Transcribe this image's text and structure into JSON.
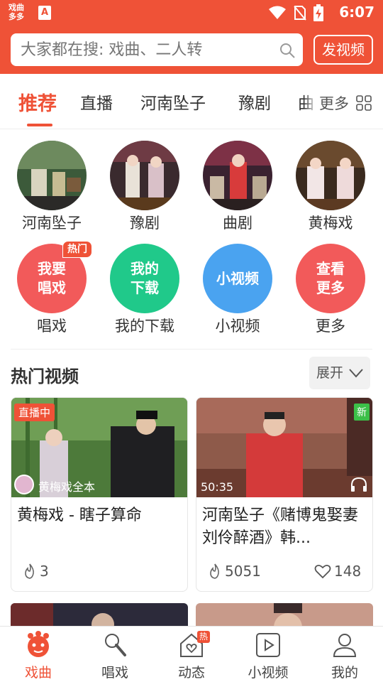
{
  "status_bar": {
    "app_logo": "戏曲多多",
    "time": "6:07"
  },
  "search": {
    "placeholder": "大家都在搜: 戏曲、二人转",
    "post_video_label": "发视频"
  },
  "tabs": [
    {
      "label": "推荐",
      "active": true
    },
    {
      "label": "直播"
    },
    {
      "label": "河南坠子"
    },
    {
      "label": "豫剧"
    },
    {
      "label": "曲"
    }
  ],
  "more_label": "更多",
  "categories": [
    {
      "label": "河南坠子"
    },
    {
      "label": "豫剧"
    },
    {
      "label": "曲剧"
    },
    {
      "label": "黄梅戏"
    }
  ],
  "functions": [
    {
      "circle_text": "我要唱戏",
      "label": "唱戏",
      "badge": "热门",
      "color": "#f25a5a"
    },
    {
      "circle_text": "我的下载",
      "label": "我的下载",
      "color": "#20c98a"
    },
    {
      "circle_text": "小视频",
      "label": "小视频",
      "color": "#4aa3f0"
    },
    {
      "circle_text": "查看更多",
      "label": "更多",
      "color": "#f25a5a"
    }
  ],
  "hot_videos": {
    "title": "热门视频",
    "expand_label": "展开",
    "cards": [
      {
        "title": "黄梅戏 - 瞎子算命",
        "badge": "直播中",
        "author": "黄梅戏全本",
        "likes": "3"
      },
      {
        "title": "河南坠子《赌博鬼娶妻 刘伶醉酒》韩...",
        "badge": "新",
        "duration": "50:35",
        "likes": "5051",
        "favorites": "148"
      }
    ]
  },
  "bottom_nav": [
    {
      "label": "戏曲",
      "icon": "opera-mascot-icon",
      "active": true
    },
    {
      "label": "唱戏",
      "icon": "microphone-icon"
    },
    {
      "label": "动态",
      "icon": "home-heart-icon",
      "badge": "热"
    },
    {
      "label": "小视频",
      "icon": "play-box-icon"
    },
    {
      "label": "我的",
      "icon": "user-icon"
    }
  ],
  "colors": {
    "primary": "#ef5237",
    "download": "#20c98a",
    "small_video": "#4aa3f0",
    "new": "#3cbf48"
  }
}
